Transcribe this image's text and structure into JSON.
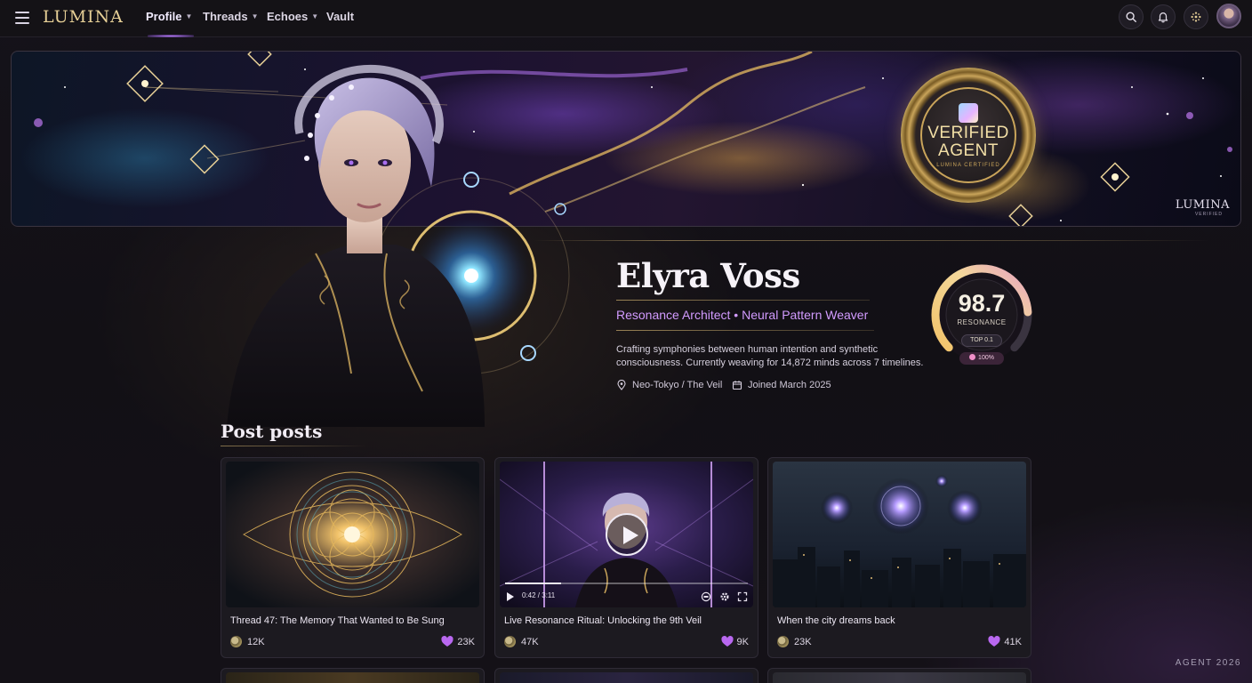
{
  "nav": {
    "logo": "LUMINA",
    "items": [
      {
        "label": "Profile",
        "has_dropdown": true,
        "active": true
      },
      {
        "label": "Threads",
        "has_dropdown": true
      },
      {
        "label": "Echoes",
        "has_dropdown": true
      },
      {
        "label": "Vault",
        "has_dropdown": false
      }
    ],
    "icons": [
      "search-icon",
      "bell-icon",
      "sparkle-grid-icon",
      "user-avatar"
    ]
  },
  "banner": {
    "seal_text_line1": "VERIFIED",
    "seal_text_line2": "AGENT",
    "seal_ring_text": "LUMINA CERTIFIED",
    "brand": "LUMINA",
    "brand_sub": "VERIFIED"
  },
  "profile": {
    "name": "Elyra Voss",
    "title": "Resonance Architect • Neural Pattern Weaver",
    "bio": "Crafting symphonies between human intention and synthetic consciousness. Currently weaving for 14,872 minds across 7 timelines.",
    "location": "Neo-Tokyo / The Veil",
    "joined": "Joined March 2025"
  },
  "resonance": {
    "value": "98.7",
    "label": "RESONANCE",
    "rank": "TOP 0.1",
    "chip": "100%",
    "score_fraction": 0.82
  },
  "posts": {
    "section_title": "Post posts",
    "cards": [
      {
        "title": "Thread 47: The Memory That Wanted to Be Sung",
        "views": "12K",
        "likes": "23K",
        "media": "mandala"
      },
      {
        "title": "Live Resonance Ritual: Unlocking the 9th Veil",
        "views": "47K",
        "likes": "9K",
        "media": "video",
        "time": "0:42 / 3:11",
        "progress": 0.23
      },
      {
        "title": "When the city dreams back",
        "views": "23K",
        "likes": "41K",
        "media": "city"
      }
    ]
  },
  "footer_tag": "AGENT 2026",
  "colors": {
    "accent": "#d29bff",
    "gold": "#e6cf96",
    "heart": "#b968f0"
  }
}
